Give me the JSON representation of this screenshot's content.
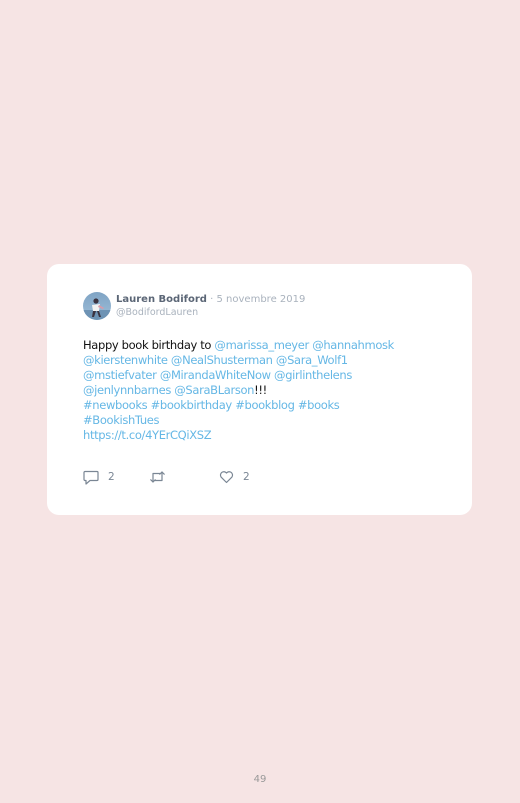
{
  "tweet": {
    "author_name": "Lauren Bodiford",
    "separator": "·",
    "date": "5 novembre 2019",
    "handle": "@BodifordLauren",
    "body": [
      [
        {
          "t": "Happy book birthday to ",
          "link": false
        },
        {
          "t": "@marissa_meyer",
          "link": true
        },
        {
          "t": " ",
          "link": false
        },
        {
          "t": "@hannahmosk",
          "link": true
        }
      ],
      [
        {
          "t": "@kierstenwhite",
          "link": true
        },
        {
          "t": " ",
          "link": false
        },
        {
          "t": "@NealShusterman",
          "link": true
        },
        {
          "t": " ",
          "link": false
        },
        {
          "t": "@Sara_Wolf1",
          "link": true
        }
      ],
      [
        {
          "t": "@mstiefvater",
          "link": true
        },
        {
          "t": " ",
          "link": false
        },
        {
          "t": "@MirandaWhiteNow",
          "link": true
        },
        {
          "t": " ",
          "link": false
        },
        {
          "t": "@girlinthelens",
          "link": true
        }
      ],
      [
        {
          "t": "@jenlynnbarnes",
          "link": true
        },
        {
          "t": " ",
          "link": false
        },
        {
          "t": "@SaraBLarson",
          "link": true
        },
        {
          "t": "!!!",
          "link": false
        }
      ],
      [
        {
          "t": "#newbooks",
          "link": true
        },
        {
          "t": " ",
          "link": false
        },
        {
          "t": "#bookbirthday",
          "link": true
        },
        {
          "t": " ",
          "link": false
        },
        {
          "t": "#bookblog",
          "link": true
        },
        {
          "t": " ",
          "link": false
        },
        {
          "t": "#books",
          "link": true
        }
      ],
      [
        {
          "t": "#BookishTues",
          "link": true
        }
      ],
      [
        {
          "t": "https://t.co/4YErCQiXSZ",
          "link": true
        }
      ]
    ],
    "replies_count": "2",
    "likes_count": "2"
  },
  "page": {
    "number": "49"
  },
  "colors": {
    "background": "#f6e4e4",
    "card": "#ffffff",
    "link": "#65b7e5",
    "meta": "#a9b2bd",
    "name": "#5b6676"
  }
}
